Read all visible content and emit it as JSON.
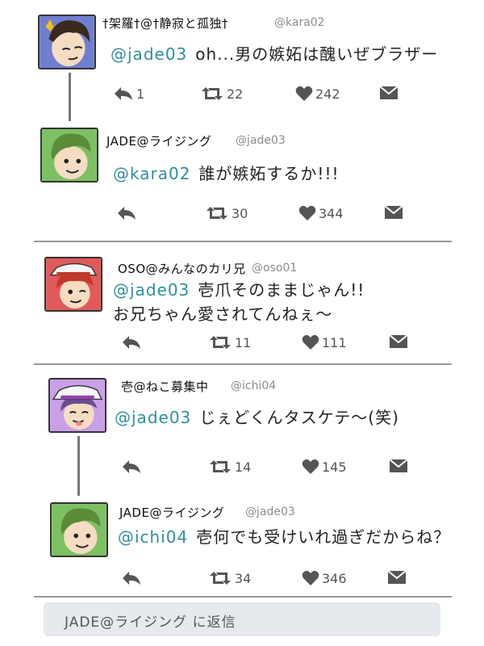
{
  "tweets": [
    {
      "name": "†架羅†@†静寂と孤独†",
      "handle": "@kara02",
      "mention": "@jade03",
      "lines": [
        "oh...男の嫉妬は醜いぜブラザー"
      ],
      "replies": "1",
      "retweets": "22",
      "likes": "242",
      "avatar_hair": "#3a2a1e",
      "avatar_bg": "#6f7fd0"
    },
    {
      "name": "JADE@ライジング",
      "handle": "@jade03",
      "mention": "@kara02",
      "lines": [
        "誰が嫉妬するか!!!"
      ],
      "replies": "",
      "retweets": "30",
      "likes": "344",
      "avatar_hair": "#5a8c3a",
      "avatar_bg": "#7cc063"
    },
    {
      "name": "OSO@みんなのカリ兄",
      "handle": "@oso01",
      "mention": "@jade03",
      "lines": [
        "壱爪そのままじゃん!!",
        "お兄ちゃん愛されてんねぇ〜"
      ],
      "replies": "",
      "retweets": "11",
      "likes": "111",
      "avatar_hair": "#c0392b",
      "avatar_bg": "#e05a5a"
    },
    {
      "name": "壱@ねこ募集中",
      "handle": "@ichi04",
      "mention": "@jade03",
      "lines": [
        "じぇどくんタスケテ〜(笑)"
      ],
      "replies": "",
      "retweets": "14",
      "likes": "145",
      "avatar_hair": "#6a4c93",
      "avatar_bg": "#c9a0e8"
    },
    {
      "name": "JADE@ライジング",
      "handle": "@jade03",
      "mention": "@ichi04",
      "lines": [
        "壱何でも受けいれ過ぎだからね？"
      ],
      "replies": "",
      "retweets": "34",
      "likes": "346",
      "avatar_hair": "#5a8c3a",
      "avatar_bg": "#7cc063"
    }
  ],
  "reply_box": {
    "placeholder": "JADE@ライジング に返信"
  },
  "icons": {
    "reply": "reply-icon",
    "retweet": "retweet-icon",
    "like": "heart-icon",
    "dm": "envelope-icon"
  }
}
